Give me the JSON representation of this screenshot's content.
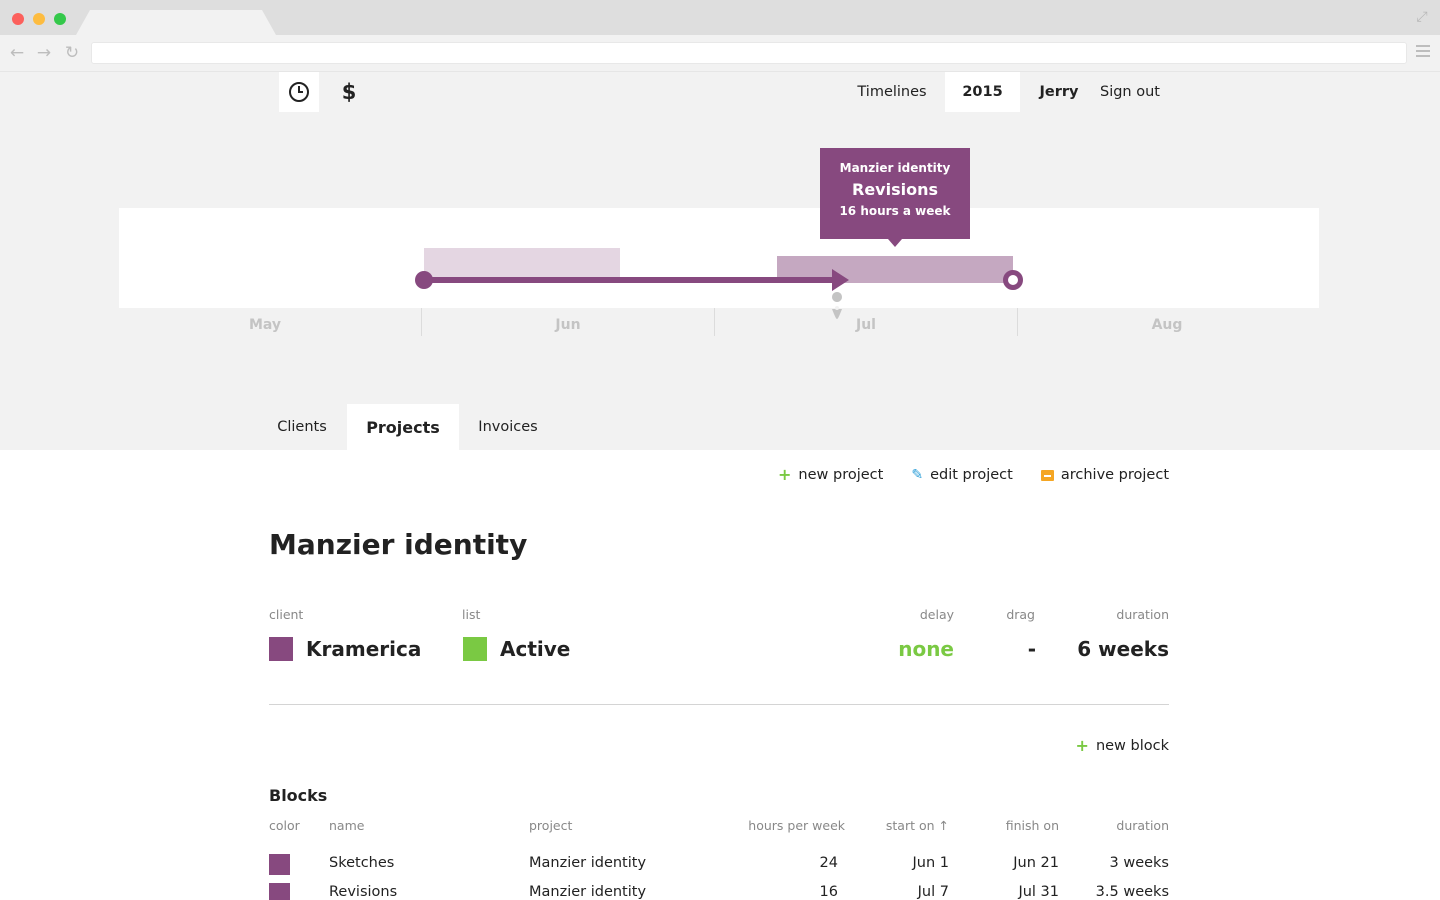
{
  "colors": {
    "purple": "#87497f",
    "purple_light": "#e4d6e2",
    "purple_mid": "#c5a8c1",
    "green": "#7ac943",
    "blue": "#2e9fd8",
    "orange": "#f5a623"
  },
  "header": {
    "icons": [
      "clock-icon",
      "dollar-icon"
    ],
    "nav": {
      "timelines": "Timelines",
      "year": "2015",
      "user": "Jerry",
      "signout": "Sign out"
    }
  },
  "timeline": {
    "months": [
      "May",
      "Jun",
      "Jul",
      "Aug"
    ],
    "tooltip": {
      "project": "Manzier identity",
      "block": "Revisions",
      "hours": "16 hours a week"
    }
  },
  "tabs": {
    "clients": "Clients",
    "projects": "Projects",
    "invoices": "Invoices"
  },
  "actions": {
    "new_project": "new project",
    "edit_project": "edit project",
    "archive_project": "archive project"
  },
  "project": {
    "title": "Manzier identity",
    "labels": {
      "client": "client",
      "list": "list",
      "delay": "delay",
      "drag": "drag",
      "duration": "duration"
    },
    "client": "Kramerica",
    "list": "Active",
    "delay": "none",
    "drag": "-",
    "duration": "6 weeks"
  },
  "blocks": {
    "new_block": "new block",
    "title": "Blocks",
    "columns": {
      "color": "color",
      "name": "name",
      "project": "project",
      "hours": "hours per week",
      "start": "start on ↑",
      "finish": "finish on",
      "duration": "duration"
    },
    "rows": [
      {
        "name": "Sketches",
        "project": "Manzier identity",
        "hours": "24",
        "start": "Jun 1",
        "finish": "Jun 21",
        "duration": "3 weeks"
      },
      {
        "name": "Revisions",
        "project": "Manzier identity",
        "hours": "16",
        "start": "Jul 7",
        "finish": "Jul 31",
        "duration": "3.5 weeks"
      }
    ]
  }
}
